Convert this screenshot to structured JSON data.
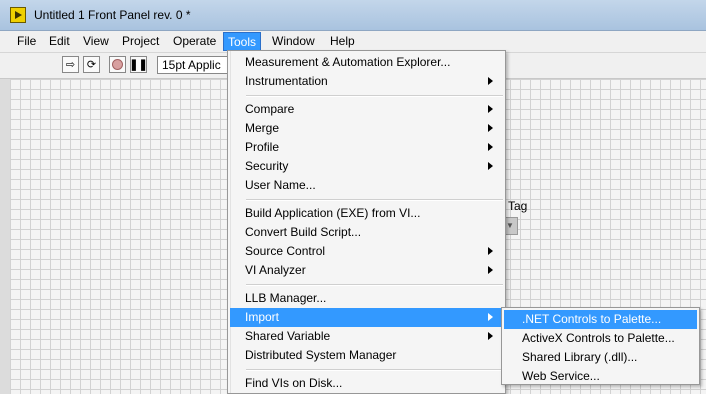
{
  "window": {
    "title": "Untitled 1 Front Panel rev. 0 *"
  },
  "menubar": {
    "items": [
      "File",
      "Edit",
      "View",
      "Project",
      "Operate",
      "Tools",
      "Window",
      "Help"
    ],
    "active": "Tools"
  },
  "toolbar": {
    "font_value": "15pt Applic"
  },
  "panel": {
    "tag_label": "Tag"
  },
  "tools_menu": {
    "items": [
      {
        "label": "Measurement & Automation Explorer...",
        "submenu": false
      },
      {
        "label": "Instrumentation",
        "submenu": true
      },
      {
        "label": "Compare",
        "submenu": true
      },
      {
        "label": "Merge",
        "submenu": true
      },
      {
        "label": "Profile",
        "submenu": true
      },
      {
        "label": "Security",
        "submenu": true
      },
      {
        "label": "User Name...",
        "submenu": false
      },
      {
        "label": "Build Application (EXE) from VI...",
        "submenu": false
      },
      {
        "label": "Convert Build Script...",
        "submenu": false
      },
      {
        "label": "Source Control",
        "submenu": true
      },
      {
        "label": "VI Analyzer",
        "submenu": true
      },
      {
        "label": "LLB Manager...",
        "submenu": false
      },
      {
        "label": "Import",
        "submenu": true,
        "highlighted": true
      },
      {
        "label": "Shared Variable",
        "submenu": true
      },
      {
        "label": "Distributed System Manager",
        "submenu": false
      },
      {
        "label": "Find VIs on Disk...",
        "submenu": false
      }
    ]
  },
  "import_submenu": {
    "items": [
      {
        "label": ".NET Controls to Palette...",
        "highlighted": true
      },
      {
        "label": "ActiveX Controls to Palette..."
      },
      {
        "label": "Shared Library (.dll)..."
      },
      {
        "label": "Web Service..."
      }
    ]
  },
  "colors": {
    "highlight": "#3399ff",
    "menu_bg": "#f5f5f5",
    "titlebar": "#b9cee6"
  }
}
